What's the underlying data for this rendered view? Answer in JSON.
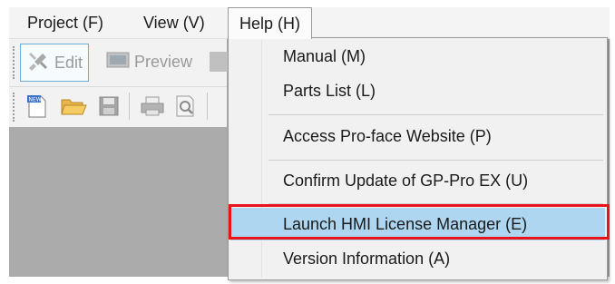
{
  "menubar": {
    "items": [
      {
        "label": "Project (F)"
      },
      {
        "label": "View (V)"
      },
      {
        "label": "Help (H)"
      }
    ]
  },
  "toolbar": {
    "edit_label": "Edit",
    "preview_label": "Preview"
  },
  "help_menu": {
    "items": [
      {
        "label": "Manual (M)"
      },
      {
        "label": "Parts List (L)"
      },
      {
        "label": "Access Pro-face Website (P)"
      },
      {
        "label": "Confirm Update of GP-Pro EX (U)"
      },
      {
        "label": "Launch HMI License Manager (E)"
      },
      {
        "label": "Version Information (A)"
      }
    ]
  },
  "colors": {
    "highlight": "#aed6f0",
    "callout_border": "#e8141b",
    "workspace": "#ababab"
  },
  "icons": [
    "edit-icon",
    "preview-icon",
    "new-project-icon",
    "open-folder-icon",
    "save-icon",
    "print-icon",
    "print-preview-icon"
  ]
}
